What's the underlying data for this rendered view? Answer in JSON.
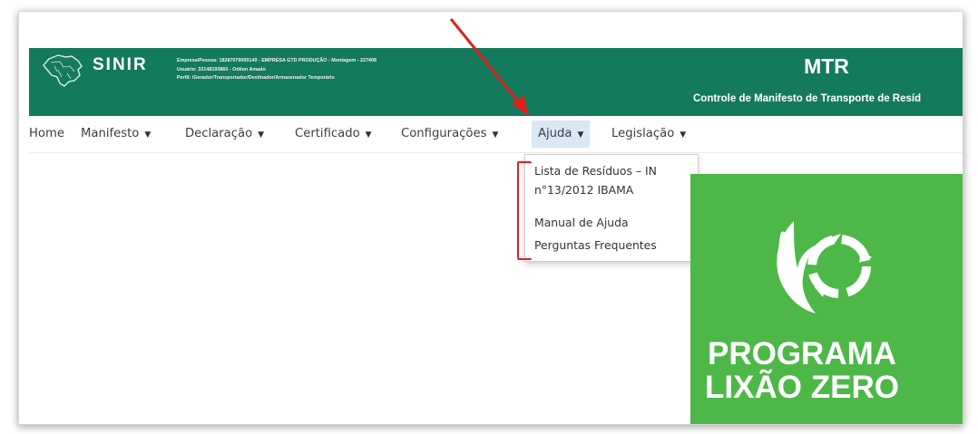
{
  "header": {
    "logo_text": "SINIR",
    "logo_subtitle": "",
    "user_lines": [
      "Empresa/Pessoa: 18287079000149 - EMPRESA GTD PRODUÇÃO - Montagem - 227408",
      "Usuário: 33148193860 - Odilon Amado",
      "Perfil: /Gerador/Transportador/Destinador/Armazenador Temporário"
    ],
    "app_title": "MTR",
    "app_subtitle": "Controle de Manifesto de Transporte de Resíd"
  },
  "nav": {
    "home": "Home",
    "items": [
      "Manifesto",
      "Declaração",
      "Certificado",
      "Configurações",
      "Ajuda",
      "Legislação"
    ],
    "active": "Ajuda"
  },
  "dropdown": {
    "items": [
      "Lista de Resíduos – IN",
      "n°13/2012 IBAMA",
      "Manual de Ajuda",
      "Perguntas Frequentes"
    ]
  },
  "banner": {
    "line1": "PROGRAMA",
    "line2": "LIXÃO ZERO",
    "color": "#4db848"
  },
  "colors": {
    "header": "#147a5c",
    "active_tab": "#d9e8f5",
    "annotation": "#e0201b"
  }
}
